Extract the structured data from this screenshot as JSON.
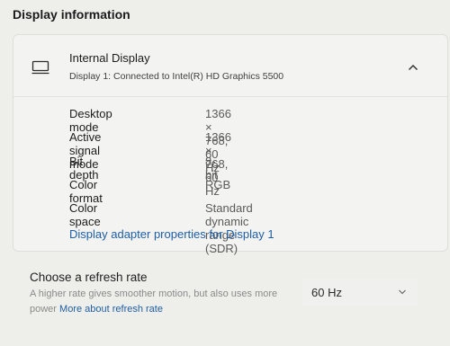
{
  "section_title": "Display information",
  "display": {
    "name": "Internal Display",
    "subtitle": "Display 1: Connected to Intel(R) HD Graphics 5500",
    "expanded": true
  },
  "details": [
    {
      "label": "Desktop mode",
      "value": "1366 × 768, 60 Hz"
    },
    {
      "label": "Active signal mode",
      "value": "1366 × 768, 60 Hz"
    },
    {
      "label": "Bit depth",
      "value": "8-bit"
    },
    {
      "label": "Color format",
      "value": "RGB"
    },
    {
      "label": "Color space",
      "value": "Standard dynamic range (SDR)"
    }
  ],
  "adapter_link": "Display adapter properties for Display 1",
  "refresh": {
    "title": "Choose a refresh rate",
    "description": "A higher rate gives smoother motion, but also uses more power",
    "link": "More about refresh rate",
    "selected": "60 Hz"
  },
  "icons": {
    "display": "monitor-icon",
    "expand": "chevron-up-icon",
    "dropdown": "chevron-down-icon"
  },
  "colors": {
    "link": "#1f5fa6",
    "background": "#eeeeeb"
  }
}
